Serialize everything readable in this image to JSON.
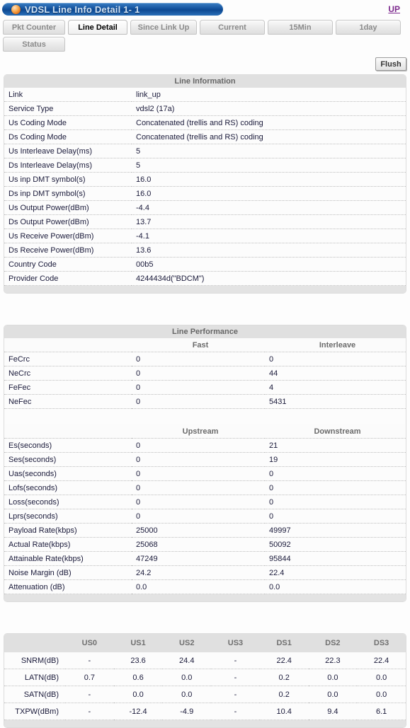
{
  "header": {
    "title": "VDSL Line Info Detail 1- 1",
    "bullet_icon": "orange-sphere-icon",
    "up_link": "UP"
  },
  "tabs": {
    "row1": [
      {
        "label": "Pkt Counter",
        "active": false
      },
      {
        "label": "Line Detail",
        "active": true
      },
      {
        "label": "Since Link Up",
        "active": false
      },
      {
        "label": "Current",
        "active": false
      },
      {
        "label": "15Min",
        "active": false
      },
      {
        "label": "1day",
        "active": false
      }
    ],
    "row2": [
      {
        "label": "Status",
        "active": false
      }
    ]
  },
  "toolbar": {
    "flush_label": "Flush"
  },
  "line_information": {
    "title": "Line Information",
    "rows": [
      {
        "label": "Link",
        "value": "link_up"
      },
      {
        "label": "Service Type",
        "value": "vdsl2 (17a)"
      },
      {
        "label": "Us Coding Mode",
        "value": "Concatenated (trellis and RS) coding"
      },
      {
        "label": "Ds Coding Mode",
        "value": "Concatenated (trellis and RS) coding"
      },
      {
        "label": "Us Interleave Delay(ms)",
        "value": "5"
      },
      {
        "label": "Ds Interleave Delay(ms)",
        "value": "5"
      },
      {
        "label": "Us inp DMT symbol(s)",
        "value": "16.0"
      },
      {
        "label": "Ds inp DMT symbol(s)",
        "value": "16.0"
      },
      {
        "label": "Us Output Power(dBm)",
        "value": "-4.4"
      },
      {
        "label": "Ds Output Power(dBm)",
        "value": "13.7"
      },
      {
        "label": "Us Receive Power(dBm)",
        "value": "-4.1"
      },
      {
        "label": "Ds Receive Power(dBm)",
        "value": "13.6"
      },
      {
        "label": "Country Code",
        "value": "00b5"
      },
      {
        "label": "Provider Code",
        "value": "4244434d(\"BDCM\")"
      }
    ]
  },
  "line_performance": {
    "title": "Line Performance",
    "fast_interleave": {
      "headers": [
        "",
        "Fast",
        "Interleave"
      ],
      "rows": [
        {
          "label": "FeCrc",
          "fast": "0",
          "interleave": "0"
        },
        {
          "label": "NeCrc",
          "fast": "0",
          "interleave": "44"
        },
        {
          "label": "FeFec",
          "fast": "0",
          "interleave": "4"
        },
        {
          "label": "NeFec",
          "fast": "0",
          "interleave": "5431"
        }
      ]
    },
    "up_down": {
      "headers": [
        "",
        "Upstream",
        "Downstream"
      ],
      "rows": [
        {
          "label": "Es(seconds)",
          "upstream": "0",
          "downstream": "21"
        },
        {
          "label": "Ses(seconds)",
          "upstream": "0",
          "downstream": "19"
        },
        {
          "label": "Uas(seconds)",
          "upstream": "0",
          "downstream": "0"
        },
        {
          "label": "Lofs(seconds)",
          "upstream": "0",
          "downstream": "0"
        },
        {
          "label": "Loss(seconds)",
          "upstream": "0",
          "downstream": "0"
        },
        {
          "label": "Lprs(seconds)",
          "upstream": "0",
          "downstream": "0"
        },
        {
          "label": "Payload Rate(kbps)",
          "upstream": "25000",
          "downstream": "49997"
        },
        {
          "label": "Actual Rate(kbps)",
          "upstream": "25068",
          "downstream": "50092"
        },
        {
          "label": "Attainable Rate(kbps)",
          "upstream": "47249",
          "downstream": "95844"
        },
        {
          "label": "Noise Margin (dB)",
          "upstream": "24.2",
          "downstream": "22.4"
        },
        {
          "label": "Attenuation (dB)",
          "upstream": "0.0",
          "downstream": "0.0"
        }
      ]
    }
  },
  "band_table": {
    "headers": [
      "",
      "US0",
      "US1",
      "US2",
      "US3",
      "DS1",
      "DS2",
      "DS3"
    ],
    "rows": [
      {
        "label": "SNRM(dB)",
        "values": [
          "-",
          "23.6",
          "24.4",
          "-",
          "22.4",
          "22.3",
          "22.4"
        ]
      },
      {
        "label": "LATN(dB)",
        "values": [
          "0.7",
          "0.6",
          "0.0",
          "-",
          "0.2",
          "0.0",
          "0.0"
        ]
      },
      {
        "label": "SATN(dB)",
        "values": [
          "-",
          "0.0",
          "0.0",
          "-",
          "0.2",
          "0.0",
          "0.0"
        ]
      },
      {
        "label": "TXPW(dBm)",
        "values": [
          "-",
          "-12.4",
          "-4.9",
          "-",
          "10.4",
          "9.4",
          "6.1"
        ]
      }
    ]
  },
  "colors": {
    "titlebar_blue": "#14539e",
    "bullet_orange": "#e4761c",
    "up_link_purple": "#7d2a8e",
    "panel_header_gray": "#e0e0e0",
    "text_navy": "#1a1a3a"
  }
}
